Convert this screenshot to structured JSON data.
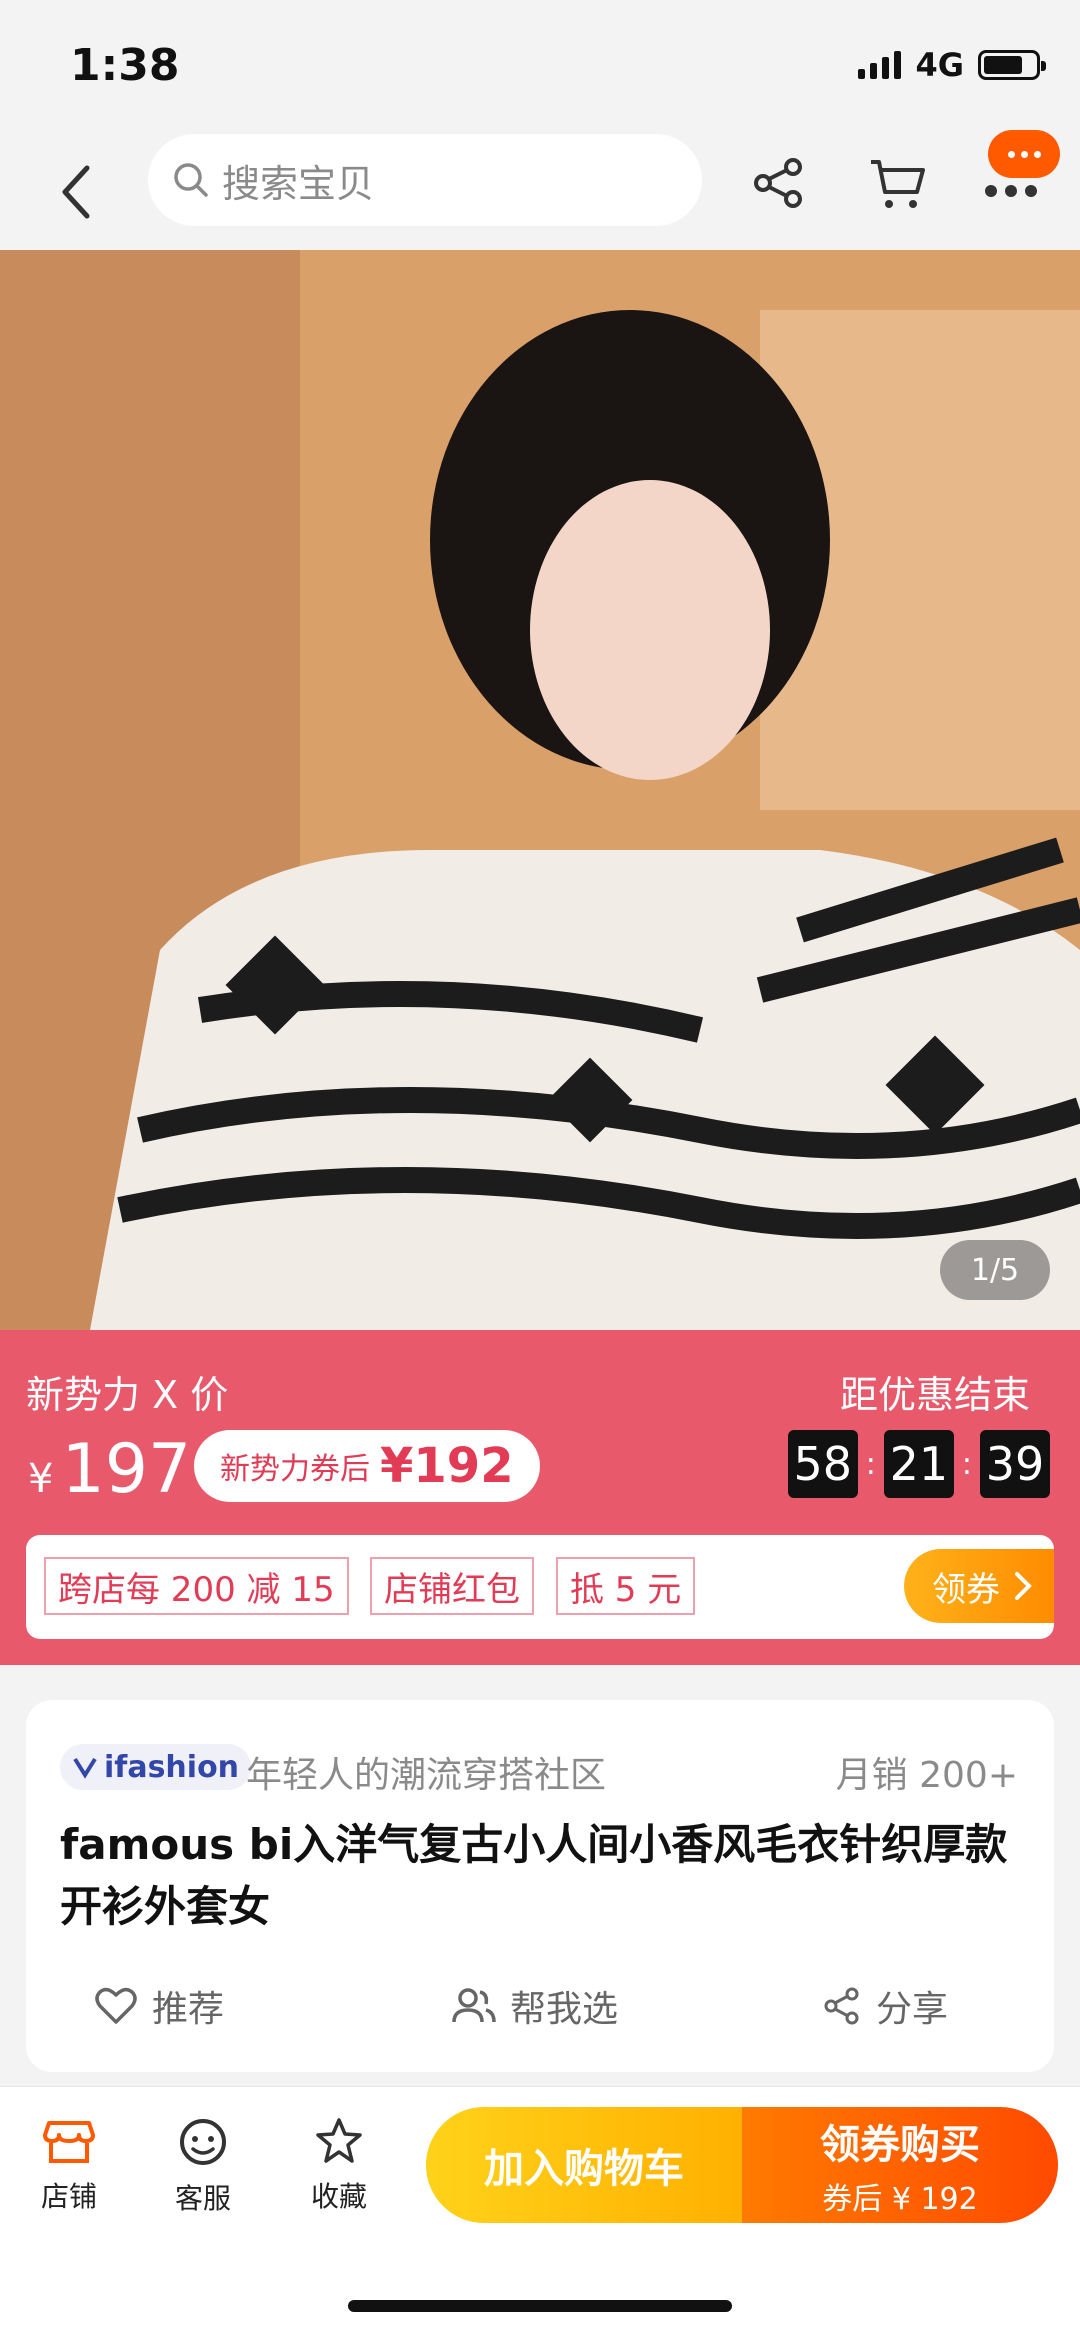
{
  "status_bar": {
    "time": "1:38",
    "network": "4G",
    "battery_level": 0.75
  },
  "nav": {
    "search_placeholder": "搜索宝贝",
    "icons": [
      "back-icon",
      "search-icon",
      "share-icon",
      "cart-icon",
      "more-icon"
    ]
  },
  "gallery": {
    "counter": "1/5"
  },
  "promo": {
    "title": "新势力 X 价",
    "price_symbol": "¥",
    "price": "197",
    "coupon_label": "新势力券后",
    "coupon_price": "¥192",
    "countdown_title": "距优惠结束",
    "countdown": {
      "hours": "58",
      "minutes": "21",
      "seconds": "39"
    }
  },
  "coupon_strip": {
    "tag1": "跨店每 200 减 15",
    "tag2": "店铺红包",
    "tag3": "抵 5 元",
    "claim_label": "领券"
  },
  "product": {
    "brand": "ifashion",
    "community": "年轻人的潮流穿搭社区",
    "monthly_sales": "月销 200+",
    "title": "famous bi入洋气复古小人间小香风毛衣针织厚款开衫外套女",
    "actions": {
      "recommend": "推荐",
      "help_choose": "帮我选",
      "share": "分享"
    }
  },
  "bottom_bar": {
    "shop": "店铺",
    "service": "客服",
    "favorite": "收藏",
    "add_to_cart": "加入购物车",
    "buy_label": "领券购买",
    "buy_sub": "券后 ¥ 192"
  },
  "colors": {
    "accent_orange": "#ff5a00",
    "promo_pink": "#e85a6b",
    "coupon_red": "#e23b56"
  }
}
